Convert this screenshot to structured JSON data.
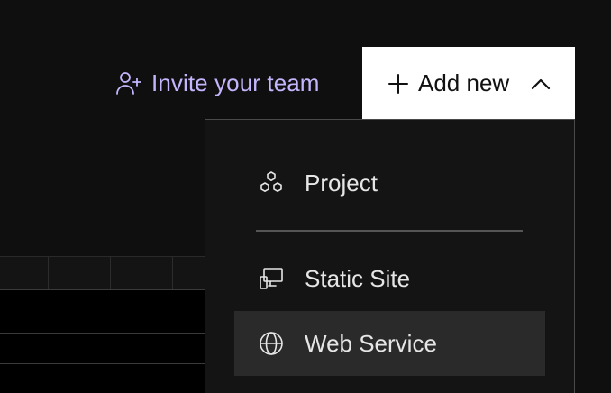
{
  "header": {
    "invite": {
      "label": "Invite your team",
      "icon": "user-plus-icon",
      "color": "#c4b5fd"
    },
    "add_new": {
      "label": "Add new",
      "leading_icon": "plus-icon",
      "trailing_icon": "chevron-up-icon",
      "expanded": true
    }
  },
  "menu": {
    "items": [
      {
        "label": "Project",
        "icon": "project-hexagons-icon",
        "highlighted": false
      },
      {
        "label": "Static Site",
        "icon": "static-site-icon",
        "highlighted": false
      },
      {
        "label": "Web Service",
        "icon": "globe-icon",
        "highlighted": true
      }
    ]
  },
  "colors": {
    "background": "#0f0f0f",
    "menu_background": "#141414",
    "menu_highlight": "#2a2a2a",
    "button_background": "#ffffff",
    "accent": "#c4b5fd"
  }
}
